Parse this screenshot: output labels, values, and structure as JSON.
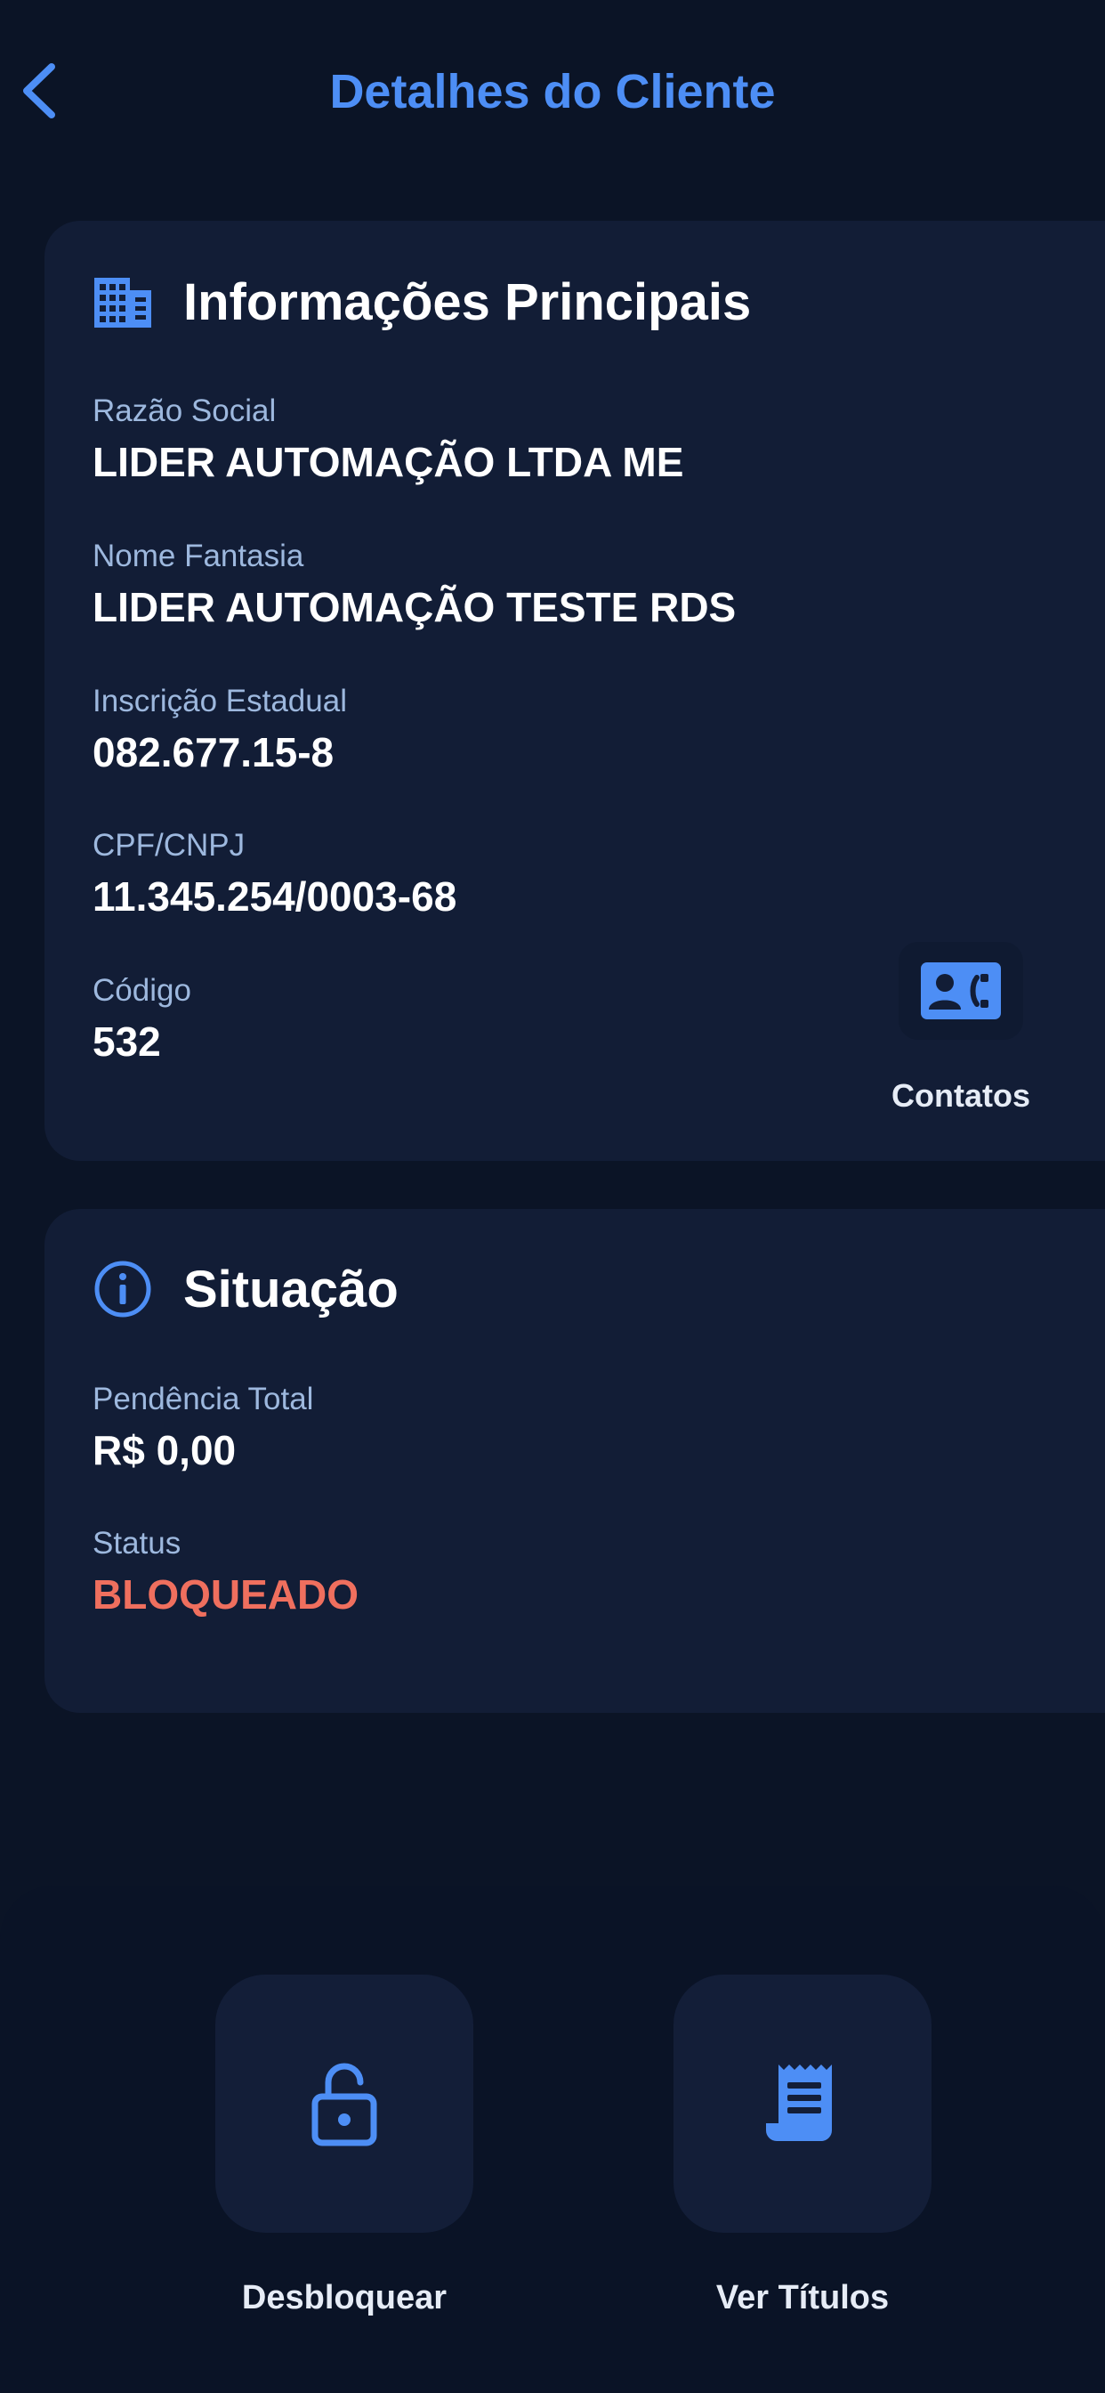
{
  "header": {
    "title": "Detalhes do Cliente",
    "back_icon": "chevron-left-icon"
  },
  "colors": {
    "background": "#0b1426",
    "card": "#121d36",
    "accent": "#4d8ef5",
    "label": "#9db8de",
    "danger": "#ef6f5e"
  },
  "main_info": {
    "icon": "building-icon",
    "title": "Informações Principais",
    "fields": [
      {
        "label": "Razão Social",
        "value": "LIDER AUTOMAÇÃO LTDA ME"
      },
      {
        "label": "Nome Fantasia",
        "value": "LIDER AUTOMAÇÃO TESTE RDS"
      },
      {
        "label": "Inscrição Estadual",
        "value": "082.677.15-8"
      },
      {
        "label": "CPF/CNPJ",
        "value": "11.345.254/0003-68"
      },
      {
        "label": "Código",
        "value": "532"
      }
    ],
    "contacts": {
      "label": "Contatos",
      "icon": "contact-phone-icon"
    }
  },
  "situation": {
    "icon": "info-icon",
    "title": "Situação",
    "fields": [
      {
        "label": "Pendência Total",
        "value": "R$ 0,00"
      },
      {
        "label": "Status",
        "value": "BLOQUEADO"
      }
    ]
  },
  "actions": [
    {
      "label": "Desbloquear",
      "icon": "unlock-icon"
    },
    {
      "label": "Ver Títulos",
      "icon": "receipt-icon"
    }
  ]
}
